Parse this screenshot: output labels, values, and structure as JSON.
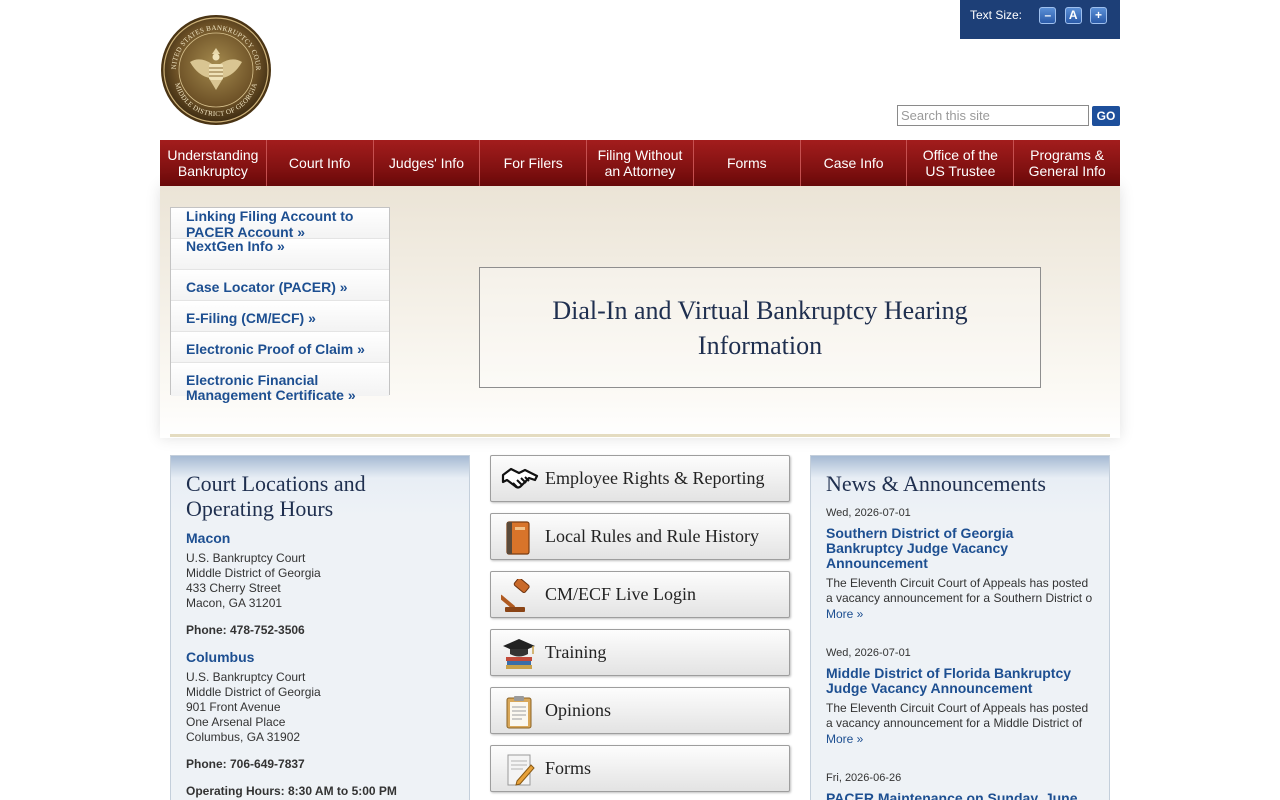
{
  "header": {
    "seal_text_top": "UNITED STATES BANKRUPTCY COURT",
    "seal_text_bottom": "MIDDLE DISTRICT OF GEORGIA",
    "text_size_label": "Text Size:",
    "text_size_buttons": [
      "–",
      "A",
      "+"
    ],
    "search_placeholder": "Search this site",
    "go_label": "GO"
  },
  "nav": [
    {
      "line1": "Understanding",
      "line2": "Bankruptcy"
    },
    {
      "line1": "Court Info",
      "line2": ""
    },
    {
      "line1": "Judges' Info",
      "line2": ""
    },
    {
      "line1": "For Filers",
      "line2": ""
    },
    {
      "line1": "Filing Without",
      "line2": "an Attorney"
    },
    {
      "line1": "Forms",
      "line2": ""
    },
    {
      "line1": "Case Info",
      "line2": ""
    },
    {
      "line1": "Office of the",
      "line2": "US Trustee"
    },
    {
      "line1": "Programs &",
      "line2": "General Info"
    }
  ],
  "quick_links": [
    {
      "line1": "Linking Filing Account to",
      "line2": "PACER Account »"
    },
    {
      "line1": "NextGen Info »",
      "line2": ""
    },
    {
      "line1": "Case Locator (PACER) »",
      "line2": ""
    },
    {
      "line1": "E-Filing (CM/ECF) »",
      "line2": ""
    },
    {
      "line1": "Electronic Proof of Claim »",
      "line2": ""
    },
    {
      "line1": "Electronic Financial",
      "line2": "Management Certificate »"
    }
  ],
  "banner": {
    "line1": "Dial-In and Virtual Bankruptcy Hearing",
    "line2": "Information"
  },
  "locations": {
    "title_line1": "Court Locations and",
    "title_line2": "Operating Hours",
    "macon": {
      "name": "Macon",
      "address": [
        "U.S. Bankruptcy Court",
        "Middle District of Georgia",
        "433 Cherry Street",
        "Macon, GA 31201"
      ],
      "phone": "Phone: 478-752-3506"
    },
    "columbus": {
      "name": "Columbus",
      "address": [
        "U.S. Bankruptcy Court",
        "Middle District of Georgia",
        "901 Front Avenue",
        "One Arsenal Place",
        "Columbus, GA 31902"
      ],
      "phone": "Phone: 706-649-7837"
    },
    "hours": "Operating Hours: 8:30 AM to 5:00 PM"
  },
  "buttons": [
    {
      "label": "Employee Rights & Reporting",
      "icon": "handshake-icon"
    },
    {
      "label": "Local Rules and Rule History",
      "icon": "book-icon"
    },
    {
      "label": "CM/ECF Live Login",
      "icon": "gavel-icon"
    },
    {
      "label": "Training",
      "icon": "graduation-cap-icon"
    },
    {
      "label": "Opinions",
      "icon": "clipboard-icon"
    },
    {
      "label": "Forms",
      "icon": "form-pencil-icon"
    }
  ],
  "news": {
    "title": "News & Announcements",
    "items": [
      {
        "date": "Wed, 2026-07-01",
        "title_lines": [
          "Southern District of Georgia",
          "Bankruptcy Judge Vacancy",
          "Announcement"
        ],
        "summary_lines": [
          "The Eleventh Circuit Court of Appeals has posted",
          "a vacancy announcement for a Southern District o"
        ],
        "more": "More »"
      },
      {
        "date": "Wed, 2026-07-01",
        "title_lines": [
          "Middle District of Florida Bankruptcy",
          "Judge Vacancy Announcement"
        ],
        "summary_lines": [
          "The Eleventh Circuit Court of Appeals has posted",
          "a vacancy announcement for a Middle District of"
        ],
        "more": "More »"
      },
      {
        "date": "Fri, 2026-06-26",
        "title_lines": [
          "PACER Maintenance on Sunday, June"
        ],
        "summary_lines": [],
        "more": ""
      }
    ]
  },
  "colors": {
    "nav_red": "#8b1414",
    "link_blue": "#1d4f91",
    "header_blue": "#1d3f77",
    "heading_navy": "#1f2f4f"
  }
}
